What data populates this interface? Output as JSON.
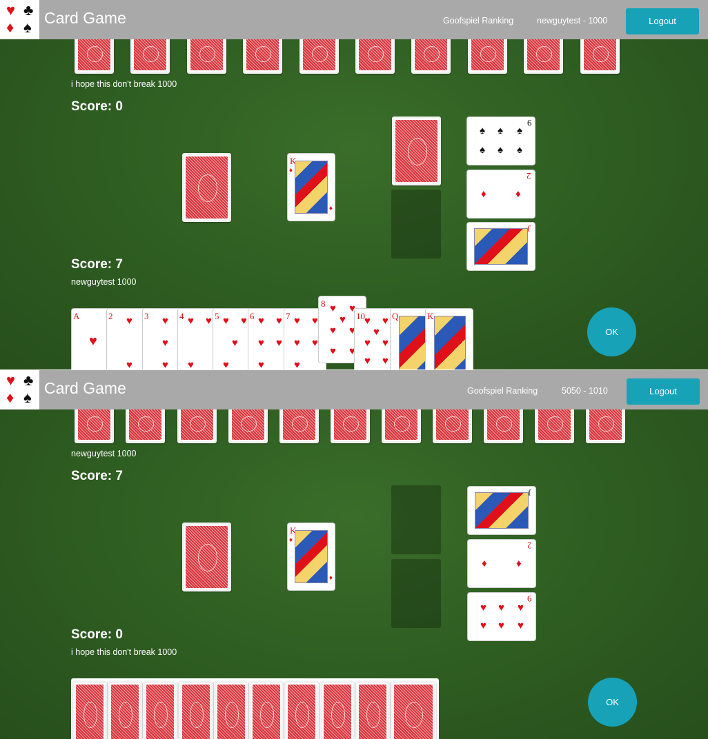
{
  "navbar": {
    "brand": "Card Game",
    "ranking_link": "Goofspiel Ranking",
    "logout_label": "Logout"
  },
  "panels": [
    {
      "user_label": "newguytest - 1000",
      "opponent": {
        "name_line": "i hope this don't break 1000",
        "score_line": "Score: 0",
        "hidden_cards": 10
      },
      "player": {
        "name_line": "newguytest 1000",
        "score_line": "Score: 7"
      },
      "prize_card": {
        "rank": "K",
        "suit": "diamonds"
      },
      "history": [
        {
          "rank": "9",
          "suit": "spades"
        },
        {
          "rank": "2",
          "suit": "diamonds"
        },
        {
          "rank": "J",
          "suit": "hearts"
        }
      ],
      "hand": [
        {
          "rank": "A",
          "suit": "hearts"
        },
        {
          "rank": "2",
          "suit": "hearts"
        },
        {
          "rank": "3",
          "suit": "hearts"
        },
        {
          "rank": "4",
          "suit": "hearts"
        },
        {
          "rank": "5",
          "suit": "hearts"
        },
        {
          "rank": "6",
          "suit": "hearts"
        },
        {
          "rank": "7",
          "suit": "hearts"
        },
        {
          "rank": "8",
          "suit": "hearts",
          "raised": true
        },
        {
          "rank": "10",
          "suit": "hearts"
        },
        {
          "rank": "Q",
          "suit": "hearts"
        },
        {
          "rank": "K",
          "suit": "hearts"
        }
      ],
      "ok_label": "OK"
    },
    {
      "user_label": "5050 - 1010",
      "opponent": {
        "name_line": "newguytest 1000",
        "score_line": "Score: 7",
        "hidden_cards": 11
      },
      "player": {
        "name_line": "i hope this don't break 1000",
        "score_line": "Score: 0"
      },
      "prize_card": {
        "rank": "K",
        "suit": "diamonds"
      },
      "history": [
        {
          "rank": "J",
          "suit": "spades"
        },
        {
          "rank": "2",
          "suit": "diamonds"
        },
        {
          "rank": "9",
          "suit": "hearts"
        }
      ],
      "hand_hidden_count": 10,
      "ok_label": "OK"
    }
  ],
  "colors": {
    "felt": "#2f5f22",
    "accent": "#17a2b8",
    "navbar": "#a9a9a9",
    "red_suit": "#e0101a",
    "card_back": "#d8343b"
  },
  "icons": {
    "logo": [
      "hearts-icon",
      "clubs-icon",
      "diamonds-icon",
      "spades-icon"
    ]
  }
}
